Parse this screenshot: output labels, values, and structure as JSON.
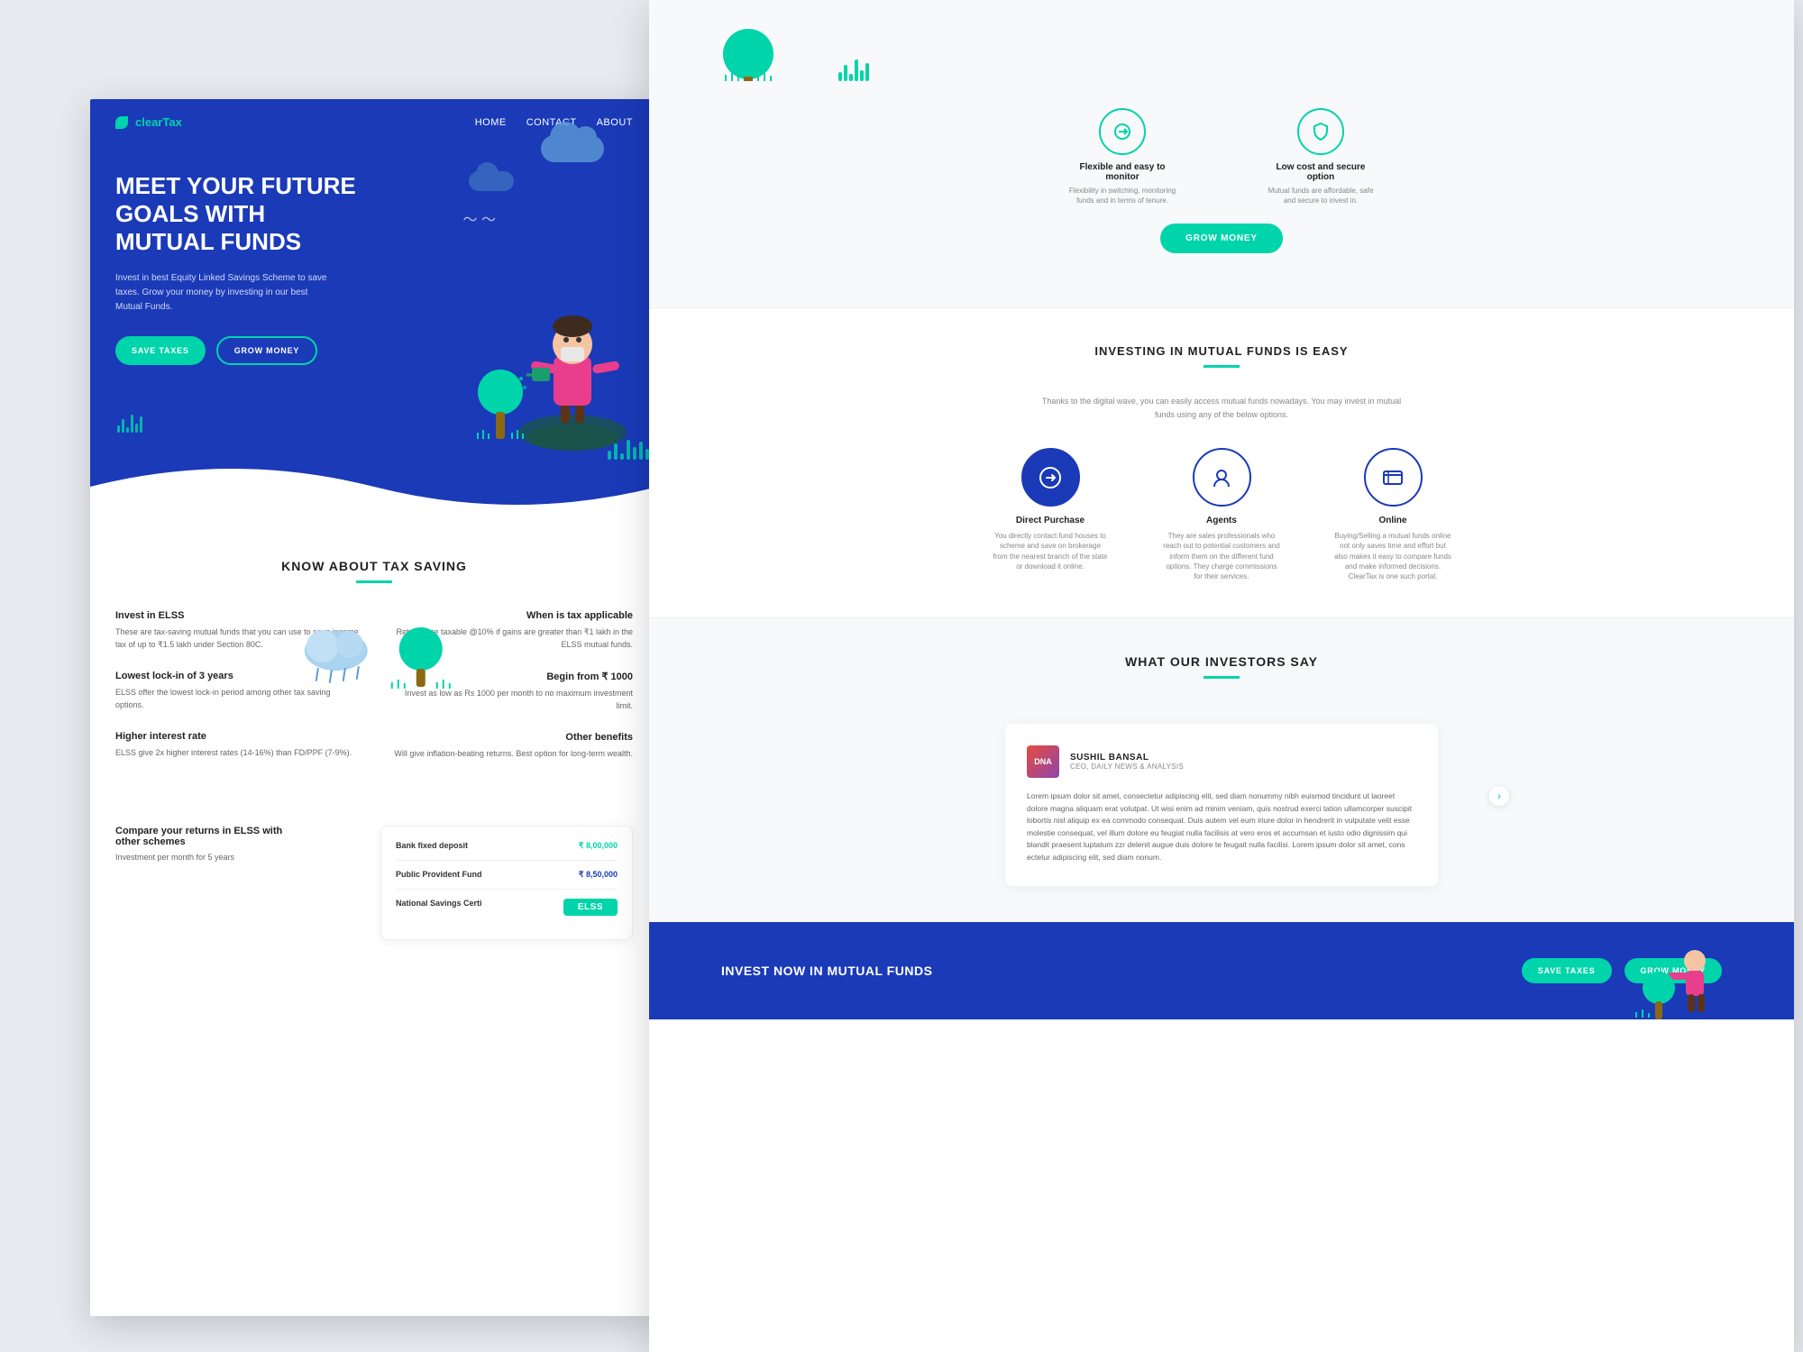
{
  "site": {
    "logo_text": "clearTax",
    "logo_icon": "🌿"
  },
  "navbar": {
    "links": [
      "HOME",
      "CONTACT",
      "ABOUT"
    ]
  },
  "hero": {
    "title": "MEET YOUR FUTURE GOALS WITH MUTUAL FUNDS",
    "subtitle": "Invest in best Equity Linked Savings Scheme to save taxes. Grow your money by investing in our best Mutual Funds.",
    "btn_save": "SAVE TAXES",
    "btn_grow": "GROW MONEY"
  },
  "tax_section": {
    "title": "KNOW ABOUT TAX SAVING",
    "items_left": [
      {
        "title": "Invest in ELSS",
        "desc": "These are tax-saving mutual funds that you can use to save income tax of up to ₹1.5 lakh under Section 80C."
      },
      {
        "title": "Lowest lock-in of 3 years",
        "desc": "ELSS offer the lowest lock-in period among other tax saving options."
      },
      {
        "title": "Higher interest rate",
        "desc": "ELSS give 2x higher interest rates (14-16%) than FD/PPF (7-9%)."
      }
    ],
    "items_right": [
      {
        "title": "When is tax applicable",
        "desc": "Returns are taxable @10% if gains are greater than ₹1 lakh in the ELSS mutual funds."
      },
      {
        "title": "Begin from ₹ 1000",
        "desc": "Invest as low as Rs 1000 per month to no maximum investment limit."
      },
      {
        "title": "Other benefits",
        "desc": "Will give inflation-beating returns. Best option for long-term wealth."
      }
    ]
  },
  "compare_section": {
    "title": "Compare your returns in ELSS with other schemes",
    "subtitle": "Investment per month for 5 years",
    "rows": [
      {
        "label": "Bank fixed deposit",
        "value": "₹ 8,00,000",
        "color": "teal"
      },
      {
        "label": "Public Provident Fund",
        "value": "₹ 8,50,000",
        "color": "blue"
      },
      {
        "label": "National Savings Certi",
        "value": "",
        "badge": "ELSS"
      }
    ]
  },
  "features_right": [
    {
      "icon": "🔄",
      "title": "Flexible and easy to monitor",
      "desc": "Flexibility in switching, monitoring funds and in terms of tenure."
    },
    {
      "icon": "🛡",
      "title": "Low cost and secure option",
      "desc": "Mutual funds are affordable, safe and secure to invest in."
    }
  ],
  "grow_money_btn": "GROW MONEY",
  "investing_section": {
    "title": "INVESTING IN MUTUAL FUNDS IS EASY",
    "desc": "Thanks to the digital wave, you can easily access mutual funds nowadays. You may invest in mutual funds using any of the below options.",
    "methods": [
      {
        "title": "Direct Purchase",
        "desc": "You directly contact fund houses to scheme and save on brokerage from the nearest branch of the state or download it online."
      },
      {
        "title": "Agents",
        "desc": "They are sales professionals who reach out to potential customers and inform them on the different fund options. They charge commissions for their services."
      },
      {
        "title": "Online",
        "desc": "Buying/Selling a mutual funds online not only saves time and effort but also makes it easy to compare funds and make informed decisions. ClearTax is one such portal."
      }
    ]
  },
  "testimonials_section": {
    "title": "WHAT OUR INVESTORS SAY",
    "testimonial": {
      "author_logo": "DNA",
      "author_name": "SUSHIL BANSAL",
      "author_title": "CEO, DAILY NEWS & ANALYSIS",
      "text": "Lorem ipsum dolor sit amet, consectetur adipiscing elit, sed diam nonummy nibh euismod tincidunt ut laoreet dolore magna aliquam erat volutpat. Ut wisi enim ad minim veniam, quis nostrud exerci tation ullamcorper suscipit lobortis nisl aliquip ex ea commodo consequat. Duis autem vel eum iriure dolor in hendrerit in vulputate velit esse molestie consequat, vel illum dolore eu feugiat nulla facilisis at vero eros et accumsan et iusto odio dignissim qui blandit praesent luptatum zzr delenit augue duis dolore te feugait nulla facilisi. Lorem ipsum dolor sit amet, cons ectetur adipiscing elit, sed diam nonum."
    },
    "arrow": "›"
  },
  "bottom_cta": {
    "title": "ST NOW IN MUTUAL FUNDS",
    "btn_save": "SAVE TAXES",
    "btn_grow": "GROW MONEY"
  }
}
